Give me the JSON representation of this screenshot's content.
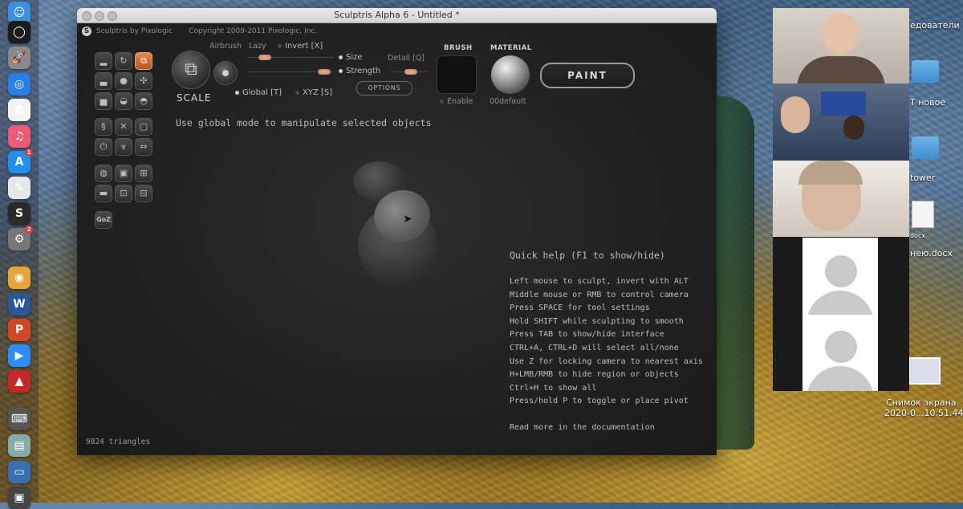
{
  "window": {
    "title": "Sculptris Alpha 6 - Untitled *",
    "brand": "Sculptris by Pixologic",
    "copyright": "Copyright  2009-2011 Pixologic, Inc."
  },
  "toolbar": {
    "tool_name": "SCALE",
    "airbrush_label": "Airbrush",
    "lazy_label": "Lazy",
    "invert_label": "Invert [X]",
    "size_label": "Size",
    "detail_label": "Detail [Q]",
    "strength_label": "Strength",
    "global_label": "Global [T]",
    "xyz_label": "XYZ [S]",
    "options_label": "OPTIONS",
    "brush_label": "BRUSH",
    "enable_label": "Enable",
    "material_label": "MATERIAL",
    "material_name": "00default",
    "paint_label": "PAINT"
  },
  "tool_icons": [
    "draw",
    "crease",
    "scale",
    "flatten",
    "inflate",
    "pinch",
    "grab",
    "smooth",
    "reduce",
    "symmetry",
    "wireframe",
    "subdivide",
    "power",
    "wave",
    "flip",
    "sphere",
    "plane",
    "merge",
    "brush-a",
    "brush-b",
    "brush-c"
  ],
  "goz_label": "GoZ",
  "hint": "Use global mode to manipulate selected objects",
  "quick_help": {
    "title": "Quick help (F1 to show/hide)",
    "lines": [
      "Left mouse to sculpt, invert with ALT",
      "Middle mouse or RMB to control camera",
      "Press SPACE for tool settings",
      "Hold SHIFT while sculpting to smooth",
      "Press TAB to show/hide interface",
      "CTRL+A, CTRL+D will select all/none",
      "Use Z for locking camera to nearest axis",
      "H+LMB/RMB to hide region or objects",
      "Ctrl+H to show all",
      "Press/hold P to toggle or place pivot"
    ],
    "more": "Read more in the documentation"
  },
  "status": {
    "triangles": "9824 triangles"
  },
  "desktop": {
    "labels": [
      "едователи",
      "Т новое",
      "tower",
      "docx",
      "нею.docx"
    ],
    "screenshot_label": "Снимок экрана",
    "screenshot_date": "2020-0...10.51.44"
  },
  "dock": [
    {
      "name": "finder-icon",
      "glyph": "☺",
      "color": "#3d8fe0"
    },
    {
      "name": "siri-icon",
      "glyph": "◯",
      "color": "#1b1b1b"
    },
    {
      "name": "launchpad-icon",
      "glyph": "🚀",
      "color": "#8a8a8a"
    },
    {
      "name": "safari-icon",
      "glyph": "◎",
      "color": "#2b7de9"
    },
    {
      "name": "photos-icon",
      "glyph": "✿",
      "color": "#f4f4f4"
    },
    {
      "name": "music-icon",
      "glyph": "♫",
      "color": "#f05a74"
    },
    {
      "name": "appstore-icon",
      "glyph": "A",
      "color": "#1f8ff0",
      "badge": "1"
    },
    {
      "name": "textedit-icon",
      "glyph": "✎",
      "color": "#e8e8e8"
    },
    {
      "name": "sculptris-dock-icon",
      "glyph": "S",
      "color": "#2a2a2a"
    },
    {
      "name": "system-preferences-icon",
      "glyph": "⚙",
      "color": "#777",
      "badge": "2"
    },
    {
      "name": "chrome-icon",
      "glyph": "◉",
      "color": "#e8a43a"
    },
    {
      "name": "word-icon",
      "glyph": "W",
      "color": "#2b579a"
    },
    {
      "name": "powerpoint-icon",
      "glyph": "P",
      "color": "#d24726"
    },
    {
      "name": "zoom-icon",
      "glyph": "▶",
      "color": "#2d8cff"
    },
    {
      "name": "app-icon",
      "glyph": "▲",
      "color": "#c62828"
    },
    {
      "name": "keyboard-icon",
      "glyph": "⌨",
      "color": "#555"
    },
    {
      "name": "preview-icon",
      "glyph": "▤",
      "color": "#8aa"
    },
    {
      "name": "folder-icon",
      "glyph": "▭",
      "color": "#3a6fb0"
    },
    {
      "name": "window-icon",
      "glyph": "▣",
      "color": "#444"
    }
  ],
  "colors": {
    "accent": "#d0733a",
    "window_bg": "#1f1f1f"
  }
}
